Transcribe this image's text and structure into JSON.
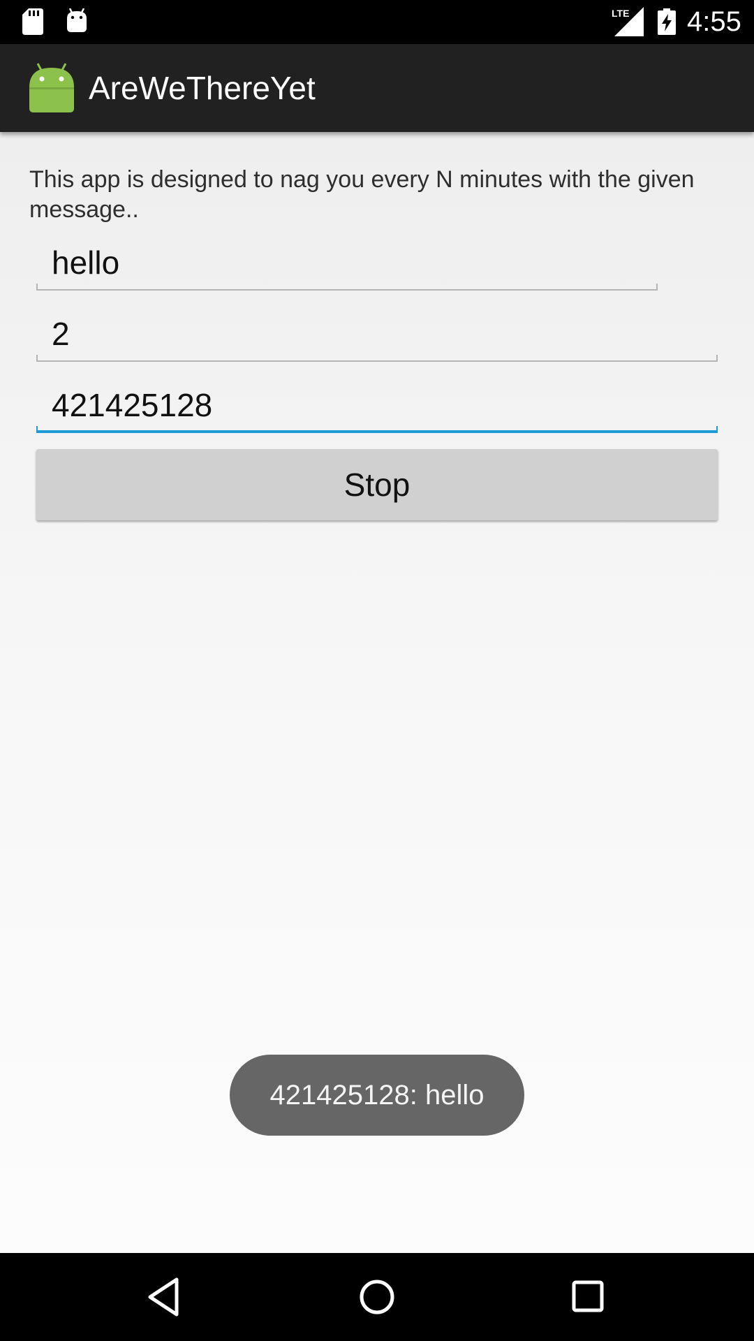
{
  "status_bar": {
    "time": "4:55",
    "network_label": "LTE",
    "icons": [
      "sd-card-icon",
      "android-debug-icon",
      "lte-signal-icon",
      "battery-charging-icon"
    ]
  },
  "action_bar": {
    "title": "AreWeThereYet",
    "icon": "android-app-icon"
  },
  "main": {
    "description": "This app is designed to nag you every N minutes with the given message..",
    "message_field": {
      "value": "hello"
    },
    "interval_field": {
      "value": "2"
    },
    "number_field": {
      "value": "421425128",
      "focused": true
    },
    "stop_button_label": "Stop"
  },
  "toast": {
    "text": "421425128: hello"
  },
  "nav_bar": {
    "icons": [
      "back-icon",
      "home-icon",
      "recents-icon"
    ]
  },
  "colors": {
    "action_bar": "#212121",
    "accent": "#1b9ad6",
    "android_green": "#8cc14c",
    "button": "#d0d0d0",
    "toast": "#666666"
  }
}
